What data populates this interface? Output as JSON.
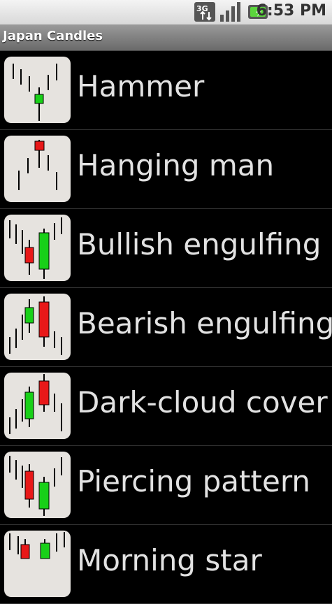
{
  "status_bar": {
    "time": "6:53 PM",
    "network_icon": "3g-data-icon",
    "signal_icon": "signal-strength-icon",
    "battery_icon": "battery-charging-icon"
  },
  "app": {
    "title": "Japan Candles"
  },
  "colors": {
    "bull": "#18d018",
    "bear": "#e81818",
    "wick": "#000000",
    "thumb_bg": "#e6e3df"
  },
  "patterns": [
    {
      "label": "Hammer",
      "icon": "hammer-candle-icon"
    },
    {
      "label": "Hanging man",
      "icon": "hanging-man-candle-icon"
    },
    {
      "label": "Bullish engulfing",
      "icon": "bullish-engulfing-candle-icon"
    },
    {
      "label": "Bearish engulfing",
      "icon": "bearish-engulfing-candle-icon"
    },
    {
      "label": "Dark-cloud cover",
      "icon": "dark-cloud-cover-candle-icon"
    },
    {
      "label": "Piercing pattern",
      "icon": "piercing-pattern-candle-icon"
    },
    {
      "label": "Morning star",
      "icon": "morning-star-candle-icon"
    }
  ]
}
